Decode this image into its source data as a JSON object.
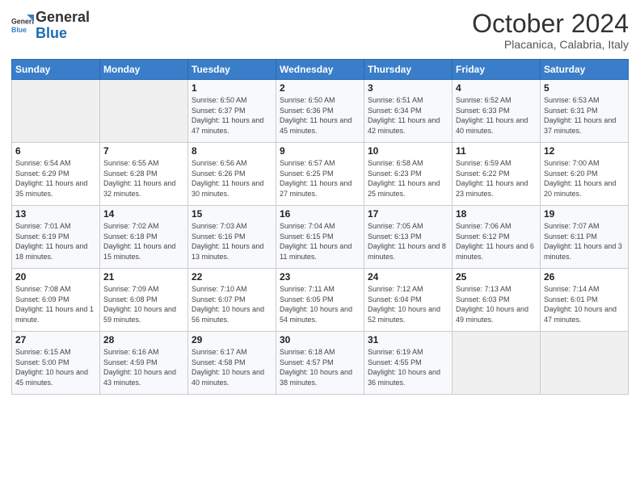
{
  "header": {
    "logo_line1": "General",
    "logo_line2": "Blue",
    "month_title": "October 2024",
    "location": "Placanica, Calabria, Italy"
  },
  "weekdays": [
    "Sunday",
    "Monday",
    "Tuesday",
    "Wednesday",
    "Thursday",
    "Friday",
    "Saturday"
  ],
  "weeks": [
    [
      {
        "day": "",
        "info": ""
      },
      {
        "day": "",
        "info": ""
      },
      {
        "day": "1",
        "info": "Sunrise: 6:50 AM\nSunset: 6:37 PM\nDaylight: 11 hours and 47 minutes."
      },
      {
        "day": "2",
        "info": "Sunrise: 6:50 AM\nSunset: 6:36 PM\nDaylight: 11 hours and 45 minutes."
      },
      {
        "day": "3",
        "info": "Sunrise: 6:51 AM\nSunset: 6:34 PM\nDaylight: 11 hours and 42 minutes."
      },
      {
        "day": "4",
        "info": "Sunrise: 6:52 AM\nSunset: 6:33 PM\nDaylight: 11 hours and 40 minutes."
      },
      {
        "day": "5",
        "info": "Sunrise: 6:53 AM\nSunset: 6:31 PM\nDaylight: 11 hours and 37 minutes."
      }
    ],
    [
      {
        "day": "6",
        "info": "Sunrise: 6:54 AM\nSunset: 6:29 PM\nDaylight: 11 hours and 35 minutes."
      },
      {
        "day": "7",
        "info": "Sunrise: 6:55 AM\nSunset: 6:28 PM\nDaylight: 11 hours and 32 minutes."
      },
      {
        "day": "8",
        "info": "Sunrise: 6:56 AM\nSunset: 6:26 PM\nDaylight: 11 hours and 30 minutes."
      },
      {
        "day": "9",
        "info": "Sunrise: 6:57 AM\nSunset: 6:25 PM\nDaylight: 11 hours and 27 minutes."
      },
      {
        "day": "10",
        "info": "Sunrise: 6:58 AM\nSunset: 6:23 PM\nDaylight: 11 hours and 25 minutes."
      },
      {
        "day": "11",
        "info": "Sunrise: 6:59 AM\nSunset: 6:22 PM\nDaylight: 11 hours and 23 minutes."
      },
      {
        "day": "12",
        "info": "Sunrise: 7:00 AM\nSunset: 6:20 PM\nDaylight: 11 hours and 20 minutes."
      }
    ],
    [
      {
        "day": "13",
        "info": "Sunrise: 7:01 AM\nSunset: 6:19 PM\nDaylight: 11 hours and 18 minutes."
      },
      {
        "day": "14",
        "info": "Sunrise: 7:02 AM\nSunset: 6:18 PM\nDaylight: 11 hours and 15 minutes."
      },
      {
        "day": "15",
        "info": "Sunrise: 7:03 AM\nSunset: 6:16 PM\nDaylight: 11 hours and 13 minutes."
      },
      {
        "day": "16",
        "info": "Sunrise: 7:04 AM\nSunset: 6:15 PM\nDaylight: 11 hours and 11 minutes."
      },
      {
        "day": "17",
        "info": "Sunrise: 7:05 AM\nSunset: 6:13 PM\nDaylight: 11 hours and 8 minutes."
      },
      {
        "day": "18",
        "info": "Sunrise: 7:06 AM\nSunset: 6:12 PM\nDaylight: 11 hours and 6 minutes."
      },
      {
        "day": "19",
        "info": "Sunrise: 7:07 AM\nSunset: 6:11 PM\nDaylight: 11 hours and 3 minutes."
      }
    ],
    [
      {
        "day": "20",
        "info": "Sunrise: 7:08 AM\nSunset: 6:09 PM\nDaylight: 11 hours and 1 minute."
      },
      {
        "day": "21",
        "info": "Sunrise: 7:09 AM\nSunset: 6:08 PM\nDaylight: 10 hours and 59 minutes."
      },
      {
        "day": "22",
        "info": "Sunrise: 7:10 AM\nSunset: 6:07 PM\nDaylight: 10 hours and 56 minutes."
      },
      {
        "day": "23",
        "info": "Sunrise: 7:11 AM\nSunset: 6:05 PM\nDaylight: 10 hours and 54 minutes."
      },
      {
        "day": "24",
        "info": "Sunrise: 7:12 AM\nSunset: 6:04 PM\nDaylight: 10 hours and 52 minutes."
      },
      {
        "day": "25",
        "info": "Sunrise: 7:13 AM\nSunset: 6:03 PM\nDaylight: 10 hours and 49 minutes."
      },
      {
        "day": "26",
        "info": "Sunrise: 7:14 AM\nSunset: 6:01 PM\nDaylight: 10 hours and 47 minutes."
      }
    ],
    [
      {
        "day": "27",
        "info": "Sunrise: 6:15 AM\nSunset: 5:00 PM\nDaylight: 10 hours and 45 minutes."
      },
      {
        "day": "28",
        "info": "Sunrise: 6:16 AM\nSunset: 4:59 PM\nDaylight: 10 hours and 43 minutes."
      },
      {
        "day": "29",
        "info": "Sunrise: 6:17 AM\nSunset: 4:58 PM\nDaylight: 10 hours and 40 minutes."
      },
      {
        "day": "30",
        "info": "Sunrise: 6:18 AM\nSunset: 4:57 PM\nDaylight: 10 hours and 38 minutes."
      },
      {
        "day": "31",
        "info": "Sunrise: 6:19 AM\nSunset: 4:55 PM\nDaylight: 10 hours and 36 minutes."
      },
      {
        "day": "",
        "info": ""
      },
      {
        "day": "",
        "info": ""
      }
    ]
  ]
}
